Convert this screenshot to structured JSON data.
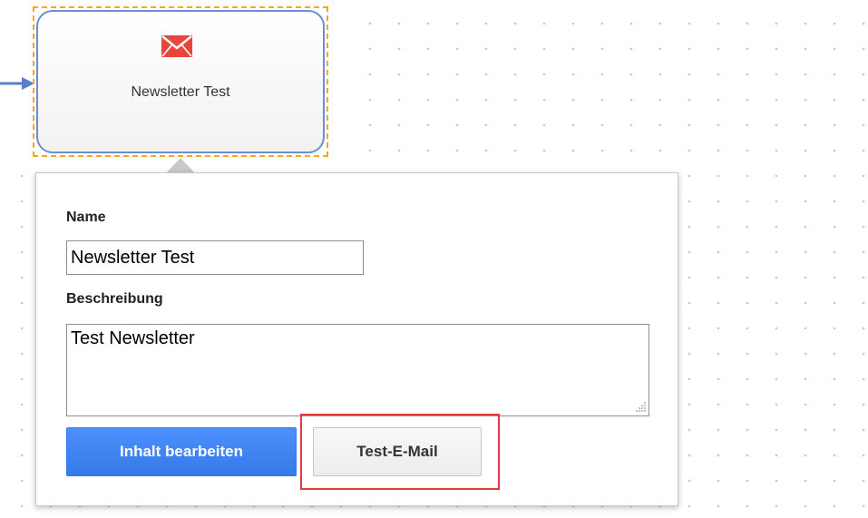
{
  "node": {
    "label": "Newsletter Test",
    "icon": "envelope-icon",
    "icon_color": "#e8453c",
    "selection_color": "#f5a623",
    "border_color": "#6a8fd0"
  },
  "connector": {
    "icon": "arrow-right-icon",
    "color": "#5b7fc7"
  },
  "panel": {
    "name_label": "Name",
    "name_value": "Newsletter Test",
    "description_label": "Beschreibung",
    "description_value": "Test Newsletter",
    "edit_button_label": "Inhalt bearbeiten",
    "test_email_button_label": "Test-E-Mail"
  },
  "colors": {
    "primary_button": "#4d90fe",
    "highlight": "#e0393e"
  }
}
